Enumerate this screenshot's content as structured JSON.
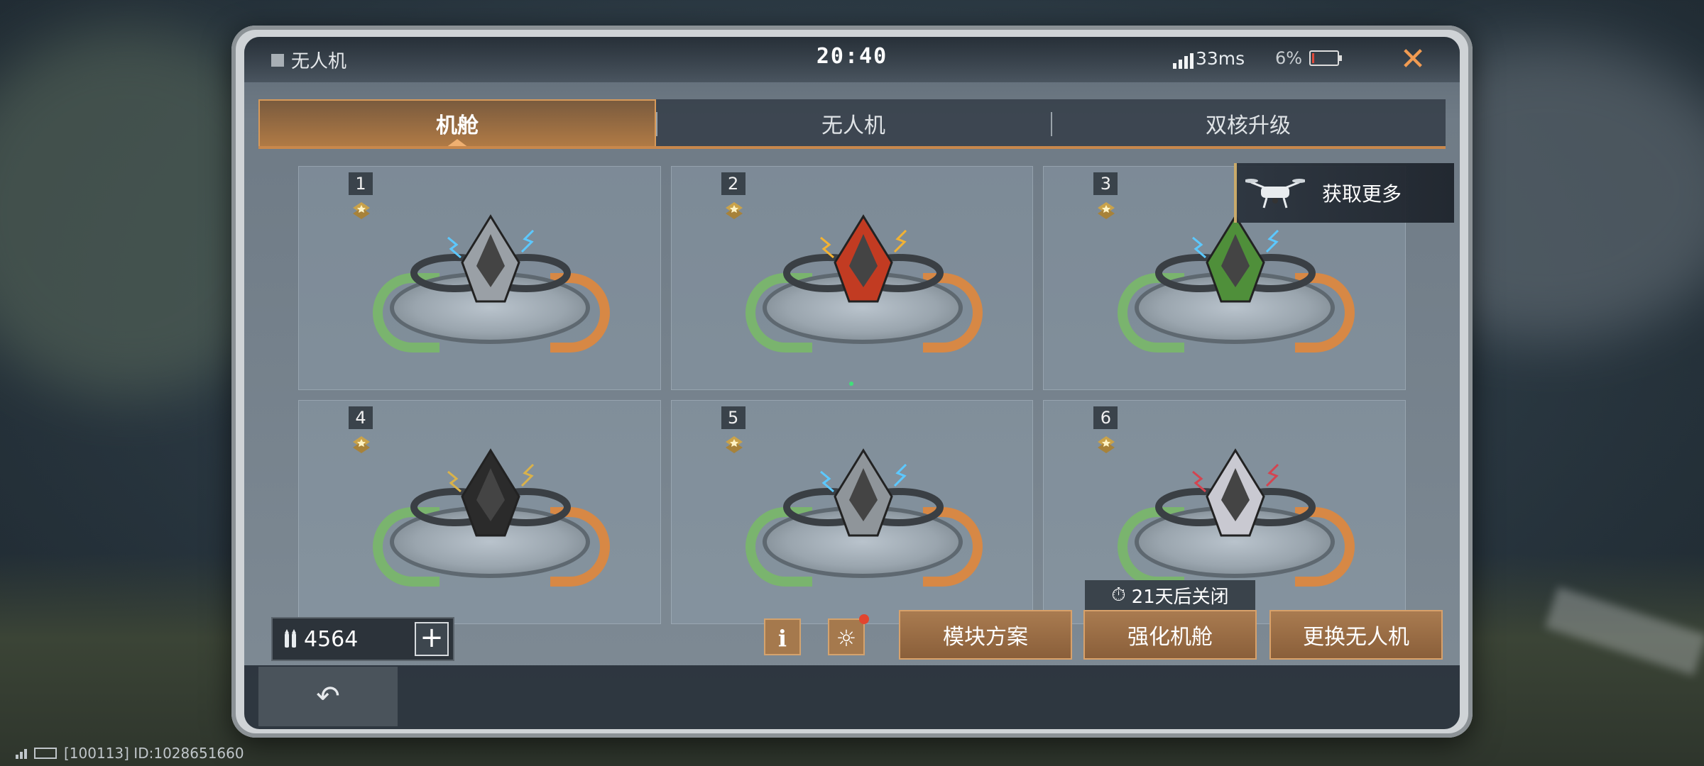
{
  "statusbar": {
    "app_title": "无人机",
    "clock": "20:40",
    "ping": "33ms",
    "battery": "6%",
    "battery_level": 0.06
  },
  "tabs": [
    {
      "label": "机舱",
      "active": true
    },
    {
      "label": "无人机",
      "active": false
    },
    {
      "label": "双核升级",
      "active": false
    }
  ],
  "get_more": {
    "label": "获取更多"
  },
  "slots": [
    {
      "num": "1",
      "color": "#9aa0a6",
      "accent": "#5cc8ff"
    },
    {
      "num": "2",
      "color": "#c23b22",
      "accent": "#f2b233"
    },
    {
      "num": "3",
      "color": "#4f8f3a",
      "accent": "#5cc8ff"
    },
    {
      "num": "4",
      "color": "#2b2b2b",
      "accent": "#d9b24a"
    },
    {
      "num": "5",
      "color": "#8f959a",
      "accent": "#5cc8ff"
    },
    {
      "num": "6",
      "color": "#c9c9d1",
      "accent": "#d34450"
    }
  ],
  "currency": {
    "value": "4564"
  },
  "timer": {
    "label": "21天后关闭"
  },
  "actions": {
    "module_plan": "模块方案",
    "upgrade_cabin": "强化机舱",
    "swap_drone": "更换无人机"
  },
  "footer": {
    "id_text": "[100113] ID:1028651660"
  },
  "colors": {
    "accent_orange": "#d78845",
    "accent_green": "#7ab46e",
    "tab_active": "#b07a45"
  }
}
